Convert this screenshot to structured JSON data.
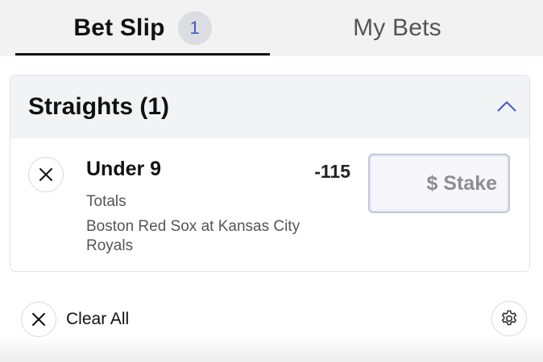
{
  "tabs": {
    "betslip_label": "Bet Slip",
    "betslip_count": "1",
    "mybets_label": "My Bets"
  },
  "section": {
    "title": "Straights (1)"
  },
  "bet": {
    "selection": "Under 9",
    "odds": "-115",
    "market": "Totals",
    "event": "Boston Red Sox at Kansas City Royals",
    "stake_placeholder": "$ Stake"
  },
  "footer": {
    "clear_all_label": "Clear All"
  },
  "colors": {
    "accent": "#4355c9",
    "text": "#111111",
    "muted": "#555555",
    "header_bg": "#f2f2f3"
  },
  "icons": {
    "collapse": "chevron-up-icon",
    "remove": "close-icon",
    "clear": "close-icon",
    "settings": "gear-icon"
  }
}
